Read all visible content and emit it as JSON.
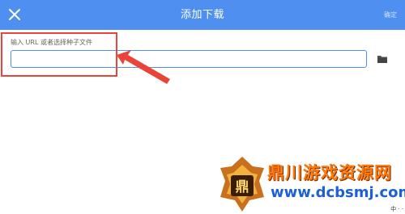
{
  "app_bar": {
    "title": "添加下载",
    "confirm_label": "确定",
    "background": "#4e8ff0"
  },
  "form": {
    "field_label": "输入 URL 或者选择种子文件",
    "input_value": "",
    "input_placeholder": "",
    "folder_icon": "folder-icon"
  },
  "icons": {
    "close": "close-icon",
    "folder": "folder-icon"
  },
  "annotation": {
    "color": "#e8443a"
  },
  "watermark": {
    "logo_text": "鼎",
    "brand": "鼎川游戏资源网",
    "url": "www.dcbsmj.com",
    "brand_color": "#ff7a0a",
    "url_color": "#1d5fd6"
  },
  "status": {
    "text": "中 · ·"
  }
}
